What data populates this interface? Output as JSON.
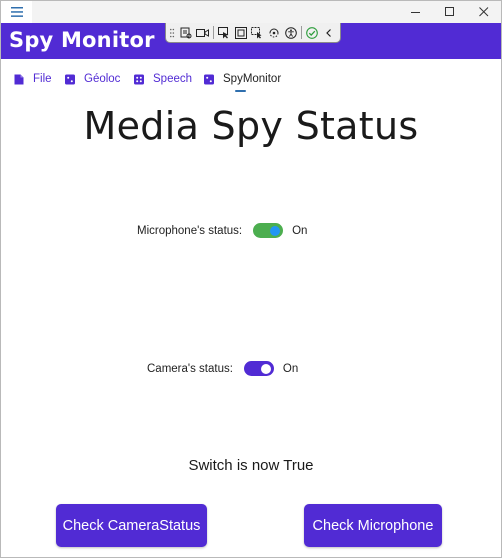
{
  "app": {
    "title": "Spy Monitor"
  },
  "window_controls": [
    "minimize-icon",
    "maximize-icon",
    "close-icon"
  ],
  "debug_toolbar": {
    "icons": [
      "live-visual-tree-icon",
      "record-video-icon",
      "select-element-icon",
      "display-layout-adorners-icon",
      "track-focus-icon",
      "hot-reload-icon",
      "accessibility-checker-icon",
      "binding-success-icon",
      "collapse-toolbar-icon"
    ]
  },
  "tabs": [
    {
      "label": "File",
      "icon": "tab-file-icon",
      "active": false
    },
    {
      "label": "Géoloc",
      "icon": "tab-geoloc-icon",
      "active": false
    },
    {
      "label": "Speech",
      "icon": "tab-speech-icon",
      "active": false
    },
    {
      "label": "SpyMonitor",
      "icon": "tab-spymonitor-icon",
      "active": true
    }
  ],
  "main": {
    "title": "Media Spy Status",
    "microphone": {
      "label": "Microphone's status:",
      "state": "On",
      "on": true
    },
    "camera": {
      "label": "Camera's status:",
      "state": "On",
      "on": true
    },
    "switch_text": "Switch is now True",
    "buttons": {
      "check_camera": "Check CameraStatus",
      "check_microphone": "Check Microphone"
    }
  },
  "colors": {
    "accent": "#512bd4",
    "toggle_green": "#4cae4f",
    "toggle_thumb_blue": "#2196f3",
    "tab_indicator": "#2f6fae"
  }
}
